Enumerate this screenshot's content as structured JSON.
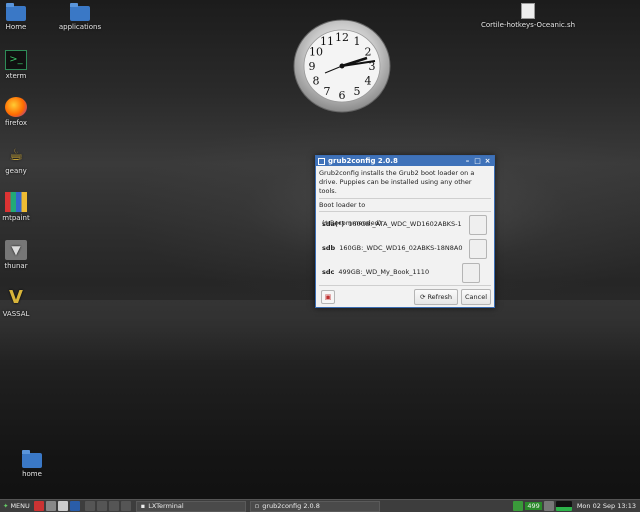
{
  "desktop": {
    "icons": [
      {
        "label": "Home"
      },
      {
        "label": "applications"
      },
      {
        "label": "xterm"
      },
      {
        "label": "firefox"
      },
      {
        "label": "geany"
      },
      {
        "label": "mtpaint"
      },
      {
        "label": "thunar"
      },
      {
        "label": "VASSAL"
      },
      {
        "label": "home"
      },
      {
        "label": "Cortile-hotkeys-Oceanic.sh"
      }
    ]
  },
  "clock": {
    "numerals": [
      "12",
      "1",
      "2",
      "3",
      "4",
      "5",
      "6",
      "7",
      "8",
      "9",
      "10",
      "11"
    ]
  },
  "window": {
    "title": "grub2config 2.0.8",
    "intro": "Grub2config installs the Grub2 boot loader on a drive. Puppies can be installed using any other tools.",
    "subhead": "Boot loader to",
    "recommended": "(*:Recommended)",
    "drives": [
      {
        "dev": "sda(*)",
        "desc": "160GB:_ATA_WDC_WD1602ABKS-1"
      },
      {
        "dev": "sdb",
        "desc": "160GB:_WDC_WD16_02ABKS-18N8A0"
      },
      {
        "dev": "sdc",
        "desc": "499GB:_WD_My_Book_1110"
      }
    ],
    "refresh_label": "Refresh",
    "cancel_label": "Cancel",
    "buttons": {
      "minimize": "–",
      "maximize": "□",
      "close": "×"
    }
  },
  "taskbar": {
    "menu_label": "MENU",
    "tasks": [
      {
        "label": "LXTerminal"
      },
      {
        "label": "grub2config 2.0.8"
      }
    ],
    "tray_badge": "499",
    "clock": "Mon 02 Sep 13:13"
  },
  "colors": {
    "titlebar": "#3f72b9",
    "taskbar": "#3d3d3d"
  }
}
